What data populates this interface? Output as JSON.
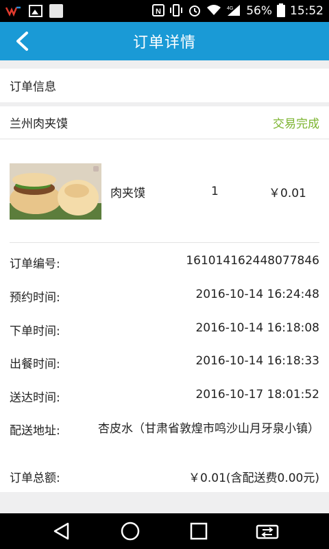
{
  "status_bar": {
    "battery": "56%",
    "time": "15:52",
    "network": "4G"
  },
  "header": {
    "title": "订单详情"
  },
  "section": {
    "title": "订单信息"
  },
  "order": {
    "shop_name": "兰州肉夹馍",
    "status": "交易完成",
    "status_color": "#7cb430",
    "item": {
      "name": "肉夹馍",
      "quantity": "1",
      "price": "￥0.01"
    },
    "details": [
      {
        "label": "订单编号:",
        "value": "161014162448077846"
      },
      {
        "label": "预约时间:",
        "value": "2016-10-14 16:24:48"
      },
      {
        "label": "下单时间:",
        "value": "2016-10-14 16:18:08"
      },
      {
        "label": "出餐时间:",
        "value": "2016-10-14 16:18:33"
      },
      {
        "label": "送达时间:",
        "value": "2016-10-17 18:01:52"
      },
      {
        "label": "配送地址:",
        "value": "杏皮水（甘肃省敦煌市鸣沙山月牙泉小镇）"
      },
      {
        "label": "订单总额:",
        "value": "￥0.01(含配送费0.00元)"
      }
    ]
  },
  "colors": {
    "accent": "#1a9ad6",
    "success": "#7cb430"
  }
}
